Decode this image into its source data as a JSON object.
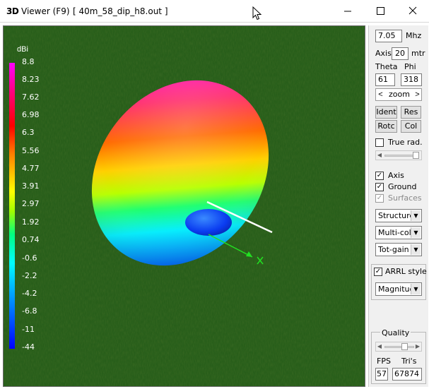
{
  "window": {
    "app_logo": "3D",
    "title": "Viewer (F9)",
    "file": "[   40m_58_dip_h8.out ]"
  },
  "legend": {
    "unit": "dBi",
    "ticks": [
      "8.8",
      "8.23",
      "7.62",
      "6.98",
      "6.3",
      "5.56",
      "4.77",
      "3.91",
      "2.97",
      "1.92",
      "0.74",
      "-0.6",
      "-2.2",
      "-4.2",
      "-6.8",
      "-11",
      "-44"
    ],
    "colors": [
      "#ff00ff",
      "#ff0000",
      "#ffff00",
      "#00ff80",
      "#00ffff",
      "#0000ff"
    ]
  },
  "panel": {
    "freq_value": "7.05",
    "freq_unit": "Mhz",
    "axis_label": "Axis",
    "axis_value": "20",
    "axis_unit": "mtr",
    "theta_label": "Theta",
    "phi_label": "Phi",
    "theta_value": "61",
    "phi_value": "318",
    "zoom_left": "<",
    "zoom_label": "zoom",
    "zoom_right": ">",
    "ident_label": "Ident",
    "res_label": "Res",
    "rotc_label": "Rotc",
    "col_label": "Col",
    "true_rad_label": "True rad.",
    "true_rad_checked": false,
    "axis_check_label": "Axis",
    "axis_checked": true,
    "ground_label": "Ground",
    "ground_checked": true,
    "surfaces_label": "Surfaces",
    "surfaces_checked": true,
    "structure_select": "Structure",
    "color_select": "Multi-color",
    "gain_select": "Tot-gain",
    "arrl_label": "ARRL style",
    "arrl_checked": true,
    "magnitude_select": "Magnitude",
    "quality_label": "Quality",
    "fps_label": "FPS",
    "tris_label": "Tri's",
    "fps_value": "57",
    "tris_value": "67874"
  }
}
